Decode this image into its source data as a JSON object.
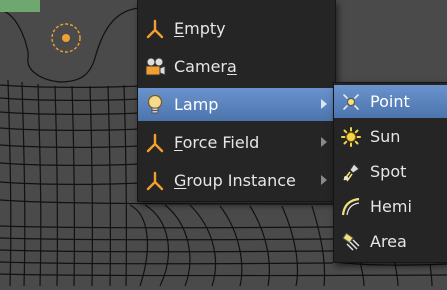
{
  "viewport": {
    "background": "#4a4a4a",
    "wire_color": "#111111",
    "origin_color": "#f0a030"
  },
  "add_menu": {
    "items": [
      {
        "pre": "",
        "mnem": "E",
        "post": "mpty",
        "icon": "empty-axes-icon",
        "submenu": false
      },
      {
        "pre": "Camer",
        "mnem": "a",
        "post": "",
        "icon": "camera-icon",
        "submenu": false
      },
      {
        "pre": "Lamp",
        "mnem": "",
        "post": "",
        "icon": "lamp-bulb-icon",
        "submenu": true
      },
      {
        "pre": "",
        "mnem": "F",
        "post": "orce Field",
        "icon": "force-field-icon",
        "submenu": true
      },
      {
        "pre": "",
        "mnem": "G",
        "post": "roup Instance",
        "icon": "group-instance-icon",
        "submenu": true
      }
    ],
    "active_index": 2
  },
  "lamp_submenu": {
    "items": [
      {
        "label": "Point",
        "icon": "point-lamp-icon"
      },
      {
        "label": "Sun",
        "icon": "sun-lamp-icon"
      },
      {
        "label": "Spot",
        "icon": "spot-lamp-icon"
      },
      {
        "label": "Hemi",
        "icon": "hemi-lamp-icon"
      },
      {
        "label": "Area",
        "icon": "area-lamp-icon"
      }
    ],
    "active_index": 0
  },
  "colors": {
    "menu_bg": "#252525",
    "highlight": "#5a82bc",
    "text": "#e6e6e6",
    "icon_orange": "#f0a030"
  }
}
